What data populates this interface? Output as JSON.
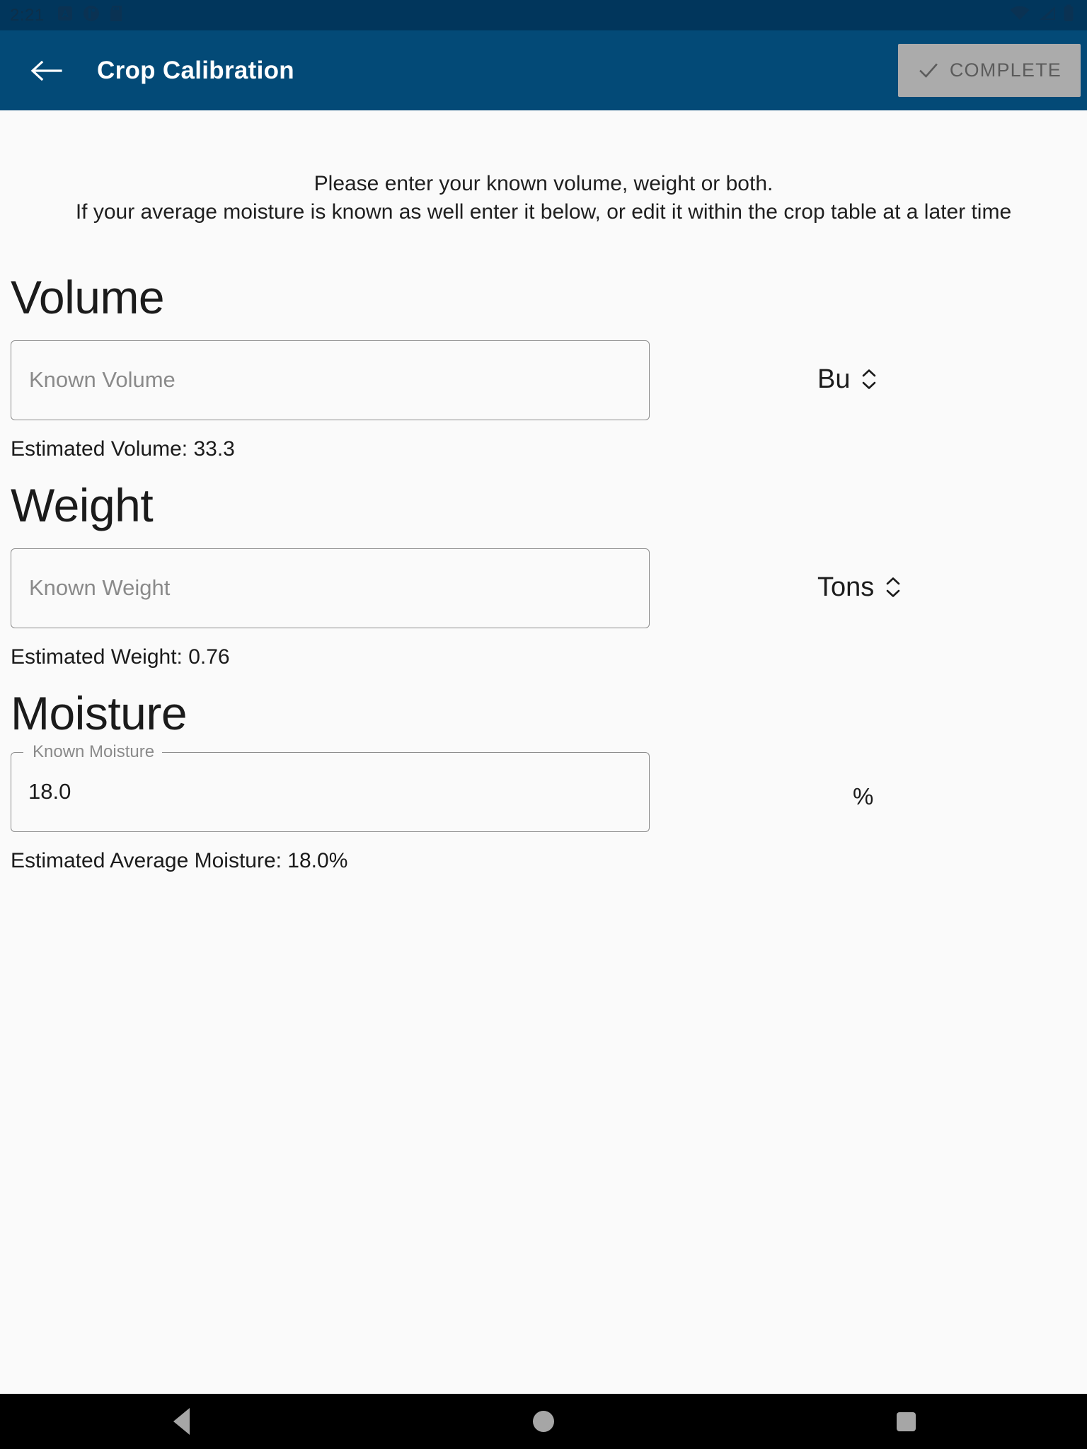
{
  "status_bar": {
    "time": "2:21",
    "left_icons": [
      "app-badge-icon",
      "circle-app-icon",
      "sd-card-icon"
    ],
    "right_icons": [
      "wifi-icon",
      "cellular-signal-icon",
      "battery-icon"
    ],
    "background_color": "#01365c"
  },
  "app_bar": {
    "back_label": "back-arrow",
    "title": "Crop Calibration",
    "complete_label": "COMPLETE",
    "background_color": "#034a77",
    "complete_button_color": "#ababab",
    "complete_text_color": "#5b5b5b"
  },
  "instructions": {
    "line1": "Please enter your known volume, weight or both.",
    "line2": "If your average moisture is known as well enter it below, or edit it within the crop table at a later time"
  },
  "volume": {
    "heading": "Volume",
    "input_placeholder": "Known Volume",
    "input_value": "",
    "unit": "Bu",
    "estimate": "Estimated Volume: 33.3"
  },
  "weight": {
    "heading": "Weight",
    "input_placeholder": "Known Weight",
    "input_value": "",
    "unit": "Tons",
    "estimate": "Estimated Weight: 0.76"
  },
  "moisture": {
    "heading": "Moisture",
    "float_label": "Known Moisture",
    "input_value": "18.0",
    "unit": "%",
    "estimate": "Estimated Average Moisture: 18.0%"
  },
  "nav_bar": {
    "back": "back-triangle-icon",
    "home": "home-circle-icon",
    "recents": "recents-square-icon",
    "background_color": "#000000",
    "icon_color": "#a6a6a6"
  }
}
